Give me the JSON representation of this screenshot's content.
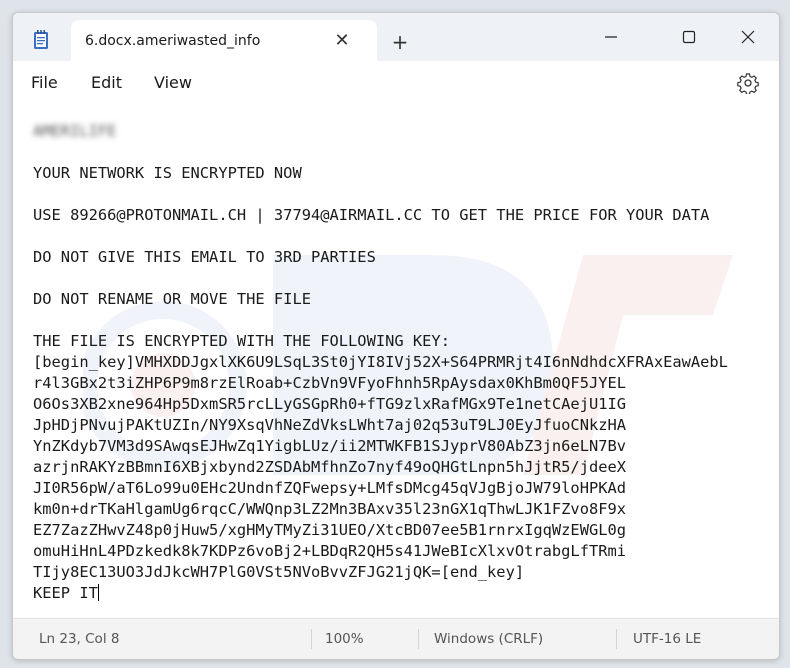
{
  "tab": {
    "title": "6.docx.ameriwasted_info",
    "close_glyph": "✕",
    "new_tab_glyph": "+"
  },
  "menu": {
    "file": "File",
    "edit": "Edit",
    "view": "View"
  },
  "editor": {
    "blurred_line": "AMERILIFE",
    "lines": [
      "",
      "YOUR NETWORK IS ENCRYPTED NOW",
      "",
      "USE 89266@PROTONMAIL.CH | 37794@AIRMAIL.CC TO GET THE PRICE FOR YOUR DATA",
      "",
      "DO NOT GIVE THIS EMAIL TO 3RD PARTIES",
      "",
      "DO NOT RENAME OR MOVE THE FILE",
      "",
      "THE FILE IS ENCRYPTED WITH THE FOLLOWING KEY:",
      "[begin_key]VMHXDDJgxlXK6U9LSqL3St0jYI8IVj52X+S64PRMRjt4I6nNdhdcXFRAxEawAebL",
      "r4l3GBx2t3iZHP6P9m8rzElRoab+CzbVn9VFyoFhnh5RpAysdax0KhBm0QF5JYEL",
      "O6Os3XB2xne964Hp5DxmSR5rcLLyGSGpRh0+fTG9zlxRafMGx9Te1netCAejU1IG",
      "JpHDjPNvujPAKtUZIn/NY9XsqVhNeZdVksLWht7aj02q53uT9LJ0EyJfuoCNkzHA",
      "YnZKdyb7VM3d9SAwqsEJHwZq1YigbLUz/ii2MTWKFB1SJyprV80AbZ3jn6eLN7Bv",
      "azrjnRAKYzBBmnI6XBjxbynd2ZSDAbMfhnZo7nyf49oQHGtLnpn5hJjtR5/jdeeX",
      "JI0R56pW/aT6Lo99u0EHc2UndnfZQFwepsy+LMfsDMcg45qVJgBjoJW79loHPKAd",
      "km0n+drTKaHlgamUg6rqcC/WWQnp3LZ2Mn3BAxv35l23nGX1qThwLJK1FZvo8F9x",
      "EZ7ZazZHwvZ48p0jHuw5/xgHMyTMyZi31UEO/XtcBD07ee5B1rnrxIgqWzEWGL0g",
      "omuHiHnL4PDzkedk8k7KDPz6voBj2+LBDqR2QH5s41JWeBIcXlxvOtrabgLfTRmi",
      "TIjy8EC13UO3JdJkcWH7PlG0VSt5NVoBvvZFJG21jQK=[end_key]"
    ],
    "last_line": "KEEP IT"
  },
  "status": {
    "position": "Ln 23, Col 8",
    "zoom": "100%",
    "line_ending": "Windows (CRLF)",
    "encoding": "UTF-16 LE"
  },
  "colors": {
    "titlebar": "#eef1f6",
    "accent_icon": "#3a6fc4"
  },
  "icons": [
    "notepad-icon",
    "close-icon",
    "plus-icon",
    "minimize-icon",
    "maximize-icon",
    "gear-icon"
  ]
}
